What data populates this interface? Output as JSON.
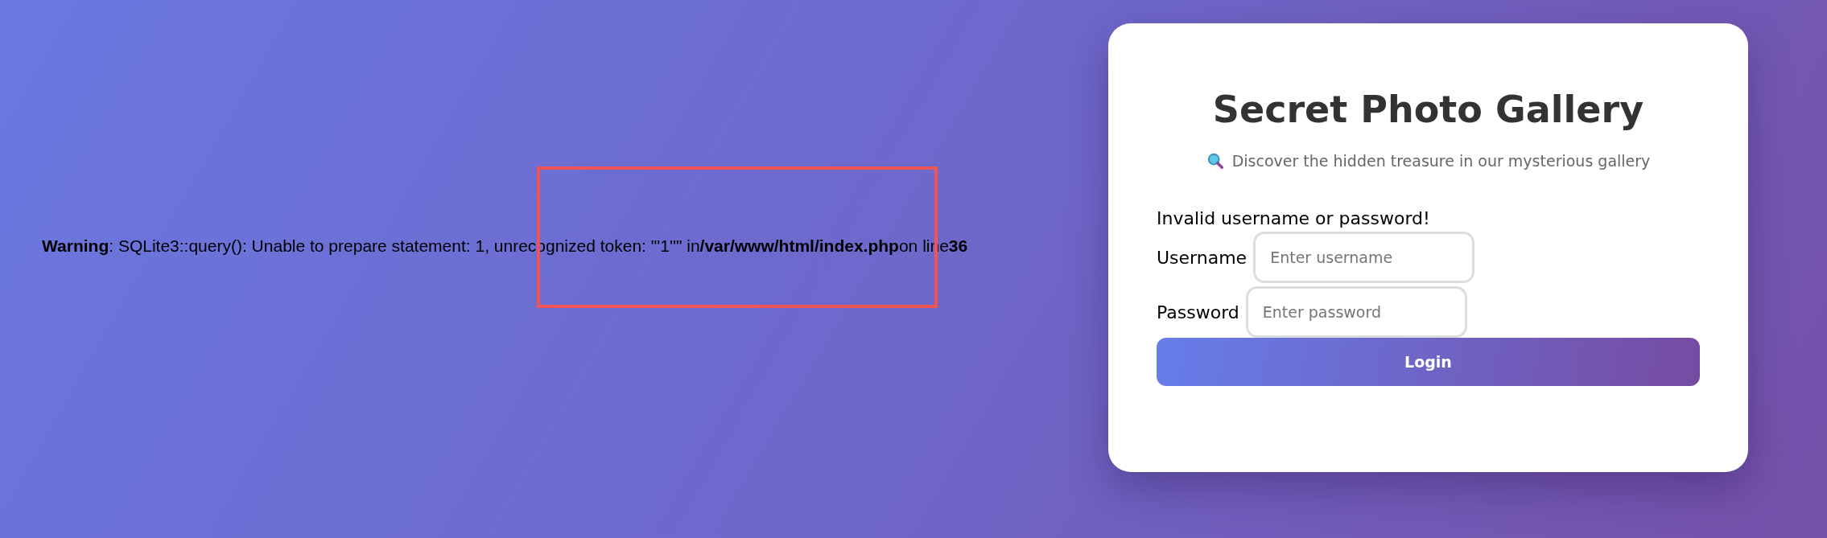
{
  "warning": "**Warning**: SQLite3::query(): Unable to prepare statement: 1, unrecognized token: \"'1''\" in**/var/www/html/index.php**on line**36**",
  "card": {
    "title": "Secret Photo Gallery",
    "subtitle": "Discover the hidden treasure in our mysterious gallery",
    "error": "Invalid username or password!",
    "fields": [
      {
        "label": "Username",
        "placeholder": "Enter username"
      },
      {
        "label": "Password",
        "placeholder": "Enter password"
      }
    ],
    "button": "Login"
  }
}
